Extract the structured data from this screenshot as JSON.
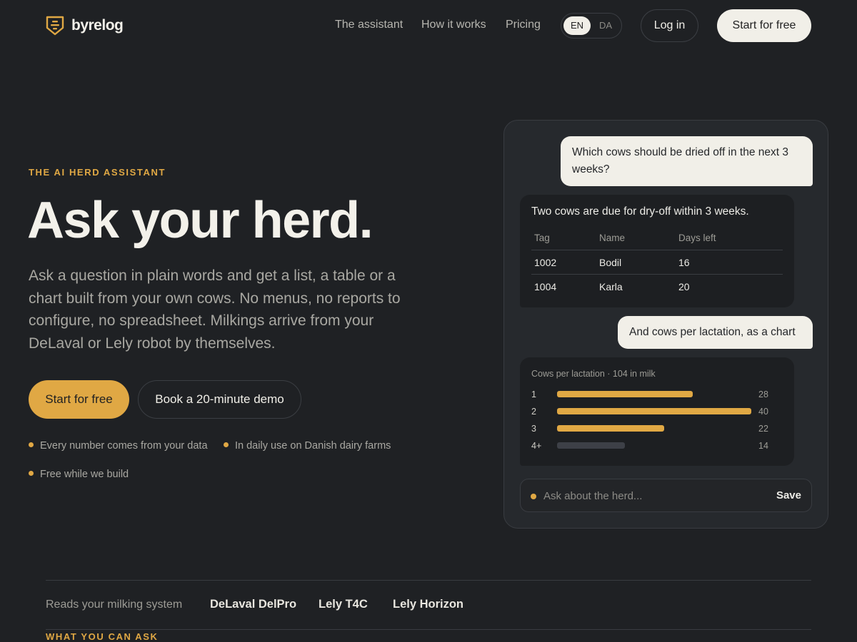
{
  "brand": {
    "name": "byrelog"
  },
  "nav": {
    "links": [
      "The assistant",
      "How it works",
      "Pricing"
    ],
    "lang": {
      "options": [
        "EN",
        "DA"
      ],
      "selected": "EN"
    },
    "login_label": "Log in",
    "start_label": "Start for free"
  },
  "hero": {
    "eyebrow": "THE AI HERD ASSISTANT",
    "title": "Ask your herd.",
    "text": "Ask a question in plain words and get a list, a table or a chart built from your own cows. No menus, no reports to configure, no spreadsheet. Milkings arrive from your DeLaval or Lely robot by themselves.",
    "primary_cta": "Start for free",
    "secondary_cta": "Book a 20-minute demo",
    "features": [
      "Every number comes from your data",
      "In daily use on Danish dairy farms",
      "Free while we build"
    ]
  },
  "chat": {
    "q1": "Which cows should be dried off in the next 3 weeks?",
    "a1": "Two cows are due for dry-off within 3 weeks.",
    "table": {
      "headers": [
        "Tag",
        "Name",
        "Days left"
      ],
      "rows": [
        [
          "1002",
          "Bodil",
          "16"
        ],
        [
          "1004",
          "Karla",
          "20"
        ]
      ]
    },
    "q2": "And cows per lactation, as a chart",
    "chart_title": "Cows per lactation · 104 in milk",
    "input_placeholder": "Ask about the herd...",
    "save_label": "Save"
  },
  "chart_data": {
    "type": "bar",
    "orientation": "horizontal",
    "title": "Cows per lactation · 104 in milk",
    "categories": [
      "1",
      "2",
      "3",
      "4+"
    ],
    "values": [
      28,
      40,
      22,
      14
    ],
    "bar_colors": [
      "#e0a844",
      "#e0a844",
      "#e0a844",
      "#3d4047"
    ]
  },
  "integrations": {
    "label": "Reads your milking system",
    "items": [
      "DeLaval DelPro",
      "Lely T4C",
      "Lely Horizon"
    ]
  },
  "next_section": {
    "eyebrow": "WHAT YOU CAN ASK"
  },
  "colors": {
    "accent": "#e0a844",
    "background": "#1f2124",
    "panel": "#26292d"
  }
}
